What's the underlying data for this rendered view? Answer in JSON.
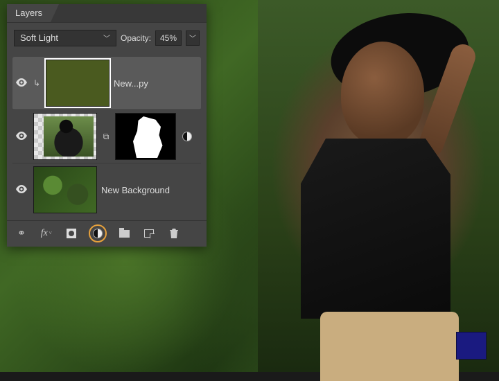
{
  "panel": {
    "tab_label": "Layers",
    "blend_mode": "Soft Light",
    "opacity_label": "Opacity:",
    "opacity_value": "45%",
    "layers": [
      {
        "name": "New...py",
        "visible": true,
        "selected": true,
        "clipped": true,
        "type": "solid",
        "color": "#4a5a1f"
      },
      {
        "name": "",
        "visible": true,
        "selected": false,
        "type": "masked-photo",
        "linked": true
      },
      {
        "name": "New Background",
        "visible": true,
        "selected": false,
        "type": "background"
      }
    ]
  },
  "icons": {
    "visibility": "eye-icon",
    "link": "link-icon",
    "clip": "clip-arrow-icon",
    "adjustment": "adjustment-icon",
    "fx": "fx-icon",
    "mask": "mask-icon",
    "folder": "folder-icon",
    "new_layer": "new-layer-icon",
    "trash": "trash-icon",
    "chevron_down": "chevron-down-icon"
  },
  "toolbar": {
    "fx_label": "fx"
  },
  "colors": {
    "panel_bg": "#454545",
    "accent_highlight": "#e8a23c",
    "swatch": "#1a1a80"
  }
}
